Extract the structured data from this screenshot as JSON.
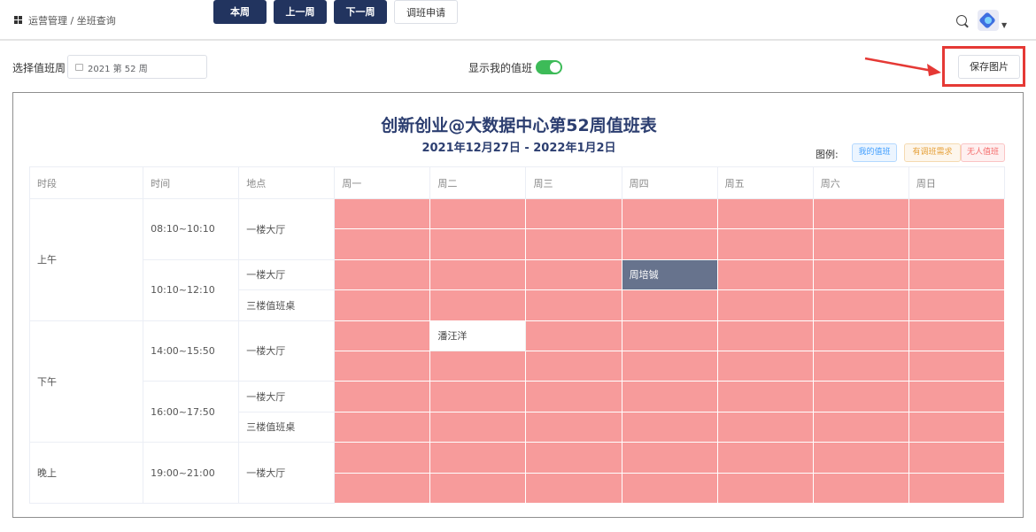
{
  "nav": {
    "breadcrumb": "运营管理 / 坐班查询"
  },
  "toolbar": {
    "week_label": "选择值班周",
    "week_value": "2021 第 52 周",
    "btn_this_week": "本周",
    "btn_prev_week": "上一周",
    "btn_next_week": "下一周",
    "btn_swap_request": "调班申请",
    "show_mine_label": "显示我的值班",
    "show_mine_on": true,
    "save_image": "保存图片"
  },
  "schedule": {
    "title": "创新创业@大数据中心第52周值班表",
    "date_range": "2021年12月27日 - 2022年1月2日",
    "legend": {
      "label": "图例:",
      "mine": "我的值班",
      "swap": "有调班需求",
      "none": "无人值班"
    },
    "headers": [
      "时段",
      "时间",
      "地点",
      "周一",
      "周二",
      "周三",
      "周四",
      "周五",
      "周六",
      "周日"
    ],
    "rows": [
      {
        "period": "上午",
        "time": "08:10~10:10",
        "place": "一楼大厅",
        "cells": [
          [
            "",
            "",
            ""
          ],
          [
            "",
            "",
            ""
          ],
          [
            "",
            "",
            ""
          ],
          [
            "",
            "",
            ""
          ],
          [
            "",
            "",
            ""
          ],
          [
            "",
            "",
            ""
          ],
          [
            "",
            "",
            ""
          ]
        ]
      },
      {
        "time": "10:10~12:10",
        "place": "一楼大厅",
        "cells": [
          [
            "",
            "",
            ""
          ],
          [
            "",
            "",
            ""
          ],
          [
            "",
            "",
            ""
          ],
          [
            "周培铖",
            "me",
            ""
          ],
          [
            "",
            "",
            ""
          ],
          [
            "",
            "",
            ""
          ],
          [
            "",
            "",
            ""
          ]
        ]
      },
      {
        "place": "三楼值班桌"
      },
      {
        "period": "下午",
        "time": "14:00~15:50",
        "place": "一楼大厅",
        "cells": [
          [
            "",
            "",
            ""
          ],
          [
            "潘汪洋",
            "sw",
            ""
          ],
          [
            "",
            "",
            ""
          ],
          [
            "",
            "",
            ""
          ],
          [
            "",
            "",
            ""
          ],
          [
            "",
            "",
            ""
          ],
          [
            "",
            "",
            ""
          ]
        ]
      },
      {
        "time": "16:00~17:50",
        "place": "一楼大厅"
      },
      {
        "place": "三楼值班桌"
      },
      {
        "period": "晚上",
        "time": "19:00~21:00",
        "place": "一楼大厅"
      }
    ]
  },
  "colors": {
    "nav_button": "#22345f",
    "no_duty": "#f79b9b",
    "my_duty": "#67738d",
    "toggle_on": "#3dbb58",
    "highlight": "#e53935"
  },
  "icons": [
    "grid-icon",
    "search-icon",
    "calendar-icon",
    "user-avatar"
  ]
}
